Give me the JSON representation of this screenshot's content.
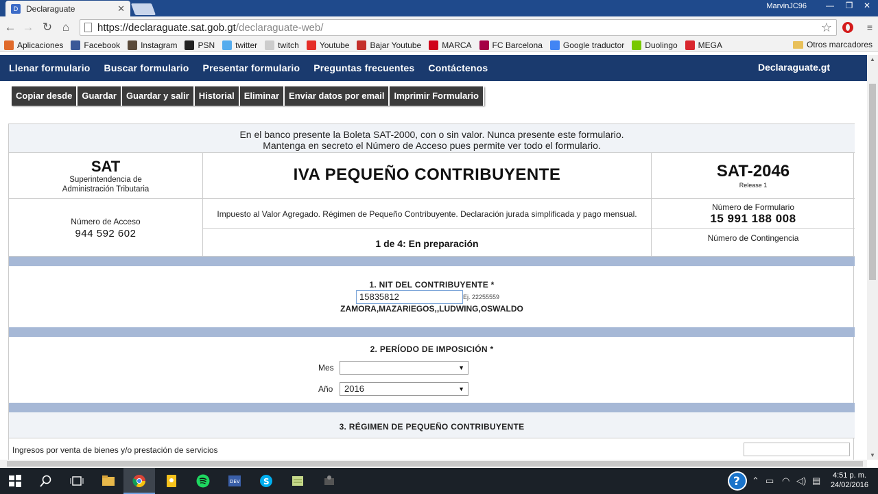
{
  "browser": {
    "tab_title": "Declaraguate",
    "tab_icon": "declaraguate-favicon",
    "user": "MarvinJC96",
    "url_host": "https://declaraguate.sat.gob.gt",
    "url_path": "/declaraguate-web/",
    "bookmarks": [
      {
        "label": "Aplicaciones",
        "icon": "apps-icon",
        "color": "#e06a2b"
      },
      {
        "label": "Facebook",
        "icon": "facebook-icon",
        "color": "#3b5998"
      },
      {
        "label": "Instagram",
        "icon": "instagram-icon",
        "color": "#5a4a3a"
      },
      {
        "label": "PSN",
        "icon": "psn-icon",
        "color": "#222222"
      },
      {
        "label": "twitter",
        "icon": "twitter-icon",
        "color": "#55acee"
      },
      {
        "label": "twitch",
        "icon": "page-icon",
        "color": "#cccccc"
      },
      {
        "label": "Youtube",
        "icon": "youtube-icon",
        "color": "#e52d27"
      },
      {
        "label": "Bajar Youtube",
        "icon": "youtube-icon",
        "color": "#c4302b"
      },
      {
        "label": "MARCA",
        "icon": "marca-icon",
        "color": "#d0021b"
      },
      {
        "label": "FC Barcelona",
        "icon": "fcb-icon",
        "color": "#a50044"
      },
      {
        "label": "Google traductor",
        "icon": "translate-icon",
        "color": "#4285f4"
      },
      {
        "label": "Duolingo",
        "icon": "duolingo-icon",
        "color": "#78c800"
      },
      {
        "label": "MEGA",
        "icon": "mega-icon",
        "color": "#d9272e"
      }
    ],
    "other_bookmarks": "Otros marcadores"
  },
  "site": {
    "nav": [
      "Llenar formulario",
      "Buscar formulario",
      "Presentar formulario",
      "Preguntas frecuentes",
      "Contáctenos"
    ],
    "brand": "Declaraguate.gt",
    "actions": [
      "Copiar desde",
      "Guardar",
      "Guardar y salir",
      "Historial",
      "Eliminar",
      "Enviar datos por email",
      "Imprimir Formulario"
    ]
  },
  "form": {
    "notice_line1": "En el banco presente la Boleta SAT-2000, con o sin valor. Nunca presente este formulario.",
    "notice_line2": "Mantenga en secreto el Número de Acceso pues permite ver todo el formulario.",
    "org_short": "SAT",
    "org_line1": "Superintendencia de",
    "org_line2": "Administración Tributaria",
    "title": "IVA PEQUEÑO CONTRIBUYENTE",
    "form_code": "SAT-2046",
    "release": "Release 1",
    "description": "Impuesto al Valor Agregado. Régimen de Pequeño Contribuyente. Declaración jurada simplificada y pago mensual.",
    "access_label": "Número de Acceso",
    "access_number": "944 592 602",
    "form_number_label": "Número de Formulario",
    "form_number": "15 991 188 008",
    "status": "1 de 4: En preparación",
    "contingency_label": "Número de Contingencia",
    "section1_title": "1. NIT DEL CONTRIBUYENTE *",
    "nit_value": "15835812",
    "nit_hint": "Ej. 22255559",
    "taxpayer_name": "ZAMORA,MAZARIEGOS,,LUDWING,OSWALDO",
    "section2_title": "2. PERÍODO DE IMPOSICIÓN *",
    "month_label": "Mes",
    "month_value": "",
    "year_label": "Año",
    "year_value": "2016",
    "section3_title": "3. RÉGIMEN DE PEQUEÑO CONTRIBUYENTE",
    "income_label": "Ingresos por venta de bienes y/o prestación de servicios",
    "income_value": ""
  },
  "taskbar": {
    "time": "4:51 p. m.",
    "date": "24/02/2016"
  }
}
